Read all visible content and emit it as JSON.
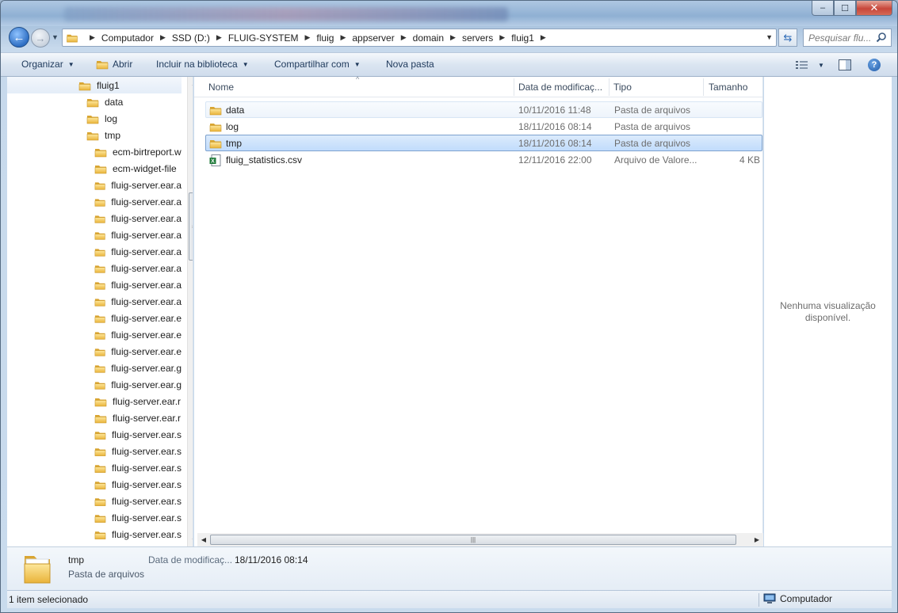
{
  "window": {
    "caption_buttons": {
      "minimize": "‒",
      "maximize": "☐",
      "close": "✕"
    }
  },
  "navigation": {
    "back_glyph": "←",
    "forward_glyph": "→",
    "recent_glyph": "▼",
    "breadcrumbs": [
      "Computador",
      "SSD (D:)",
      "FLUIG-SYSTEM",
      "fluig",
      "appserver",
      "domain",
      "servers",
      "fluig1"
    ],
    "refresh_glyph": "⇆",
    "search_placeholder": "Pesquisar flu..."
  },
  "toolbar": {
    "organize": "Organizar",
    "open": "Abrir",
    "include_library": "Incluir na biblioteca",
    "share": "Compartilhar com",
    "new_folder": "Nova pasta",
    "help": "?"
  },
  "tree": {
    "items": [
      {
        "label": "fluig1",
        "level": 0,
        "selected": true
      },
      {
        "label": "data",
        "level": 1
      },
      {
        "label": "log",
        "level": 1
      },
      {
        "label": "tmp",
        "level": 1
      },
      {
        "label": "ecm-birtreport.w",
        "level": 2
      },
      {
        "label": "ecm-widget-file",
        "level": 2
      },
      {
        "label": "fluig-server.ear.a",
        "level": 2
      },
      {
        "label": "fluig-server.ear.a",
        "level": 2
      },
      {
        "label": "fluig-server.ear.a",
        "level": 2
      },
      {
        "label": "fluig-server.ear.a",
        "level": 2
      },
      {
        "label": "fluig-server.ear.a",
        "level": 2
      },
      {
        "label": "fluig-server.ear.a",
        "level": 2
      },
      {
        "label": "fluig-server.ear.a",
        "level": 2
      },
      {
        "label": "fluig-server.ear.a",
        "level": 2
      },
      {
        "label": "fluig-server.ear.e",
        "level": 2
      },
      {
        "label": "fluig-server.ear.e",
        "level": 2
      },
      {
        "label": "fluig-server.ear.e",
        "level": 2
      },
      {
        "label": "fluig-server.ear.g",
        "level": 2
      },
      {
        "label": "fluig-server.ear.g",
        "level": 2
      },
      {
        "label": "fluig-server.ear.r",
        "level": 2
      },
      {
        "label": "fluig-server.ear.r",
        "level": 2
      },
      {
        "label": "fluig-server.ear.s",
        "level": 2
      },
      {
        "label": "fluig-server.ear.s",
        "level": 2
      },
      {
        "label": "fluig-server.ear.s",
        "level": 2
      },
      {
        "label": "fluig-server.ear.s",
        "level": 2
      },
      {
        "label": "fluig-server.ear.s",
        "level": 2
      },
      {
        "label": "fluig-server.ear.s",
        "level": 2
      },
      {
        "label": "fluig-server.ear.s",
        "level": 2
      }
    ]
  },
  "columns": {
    "name": "Nome",
    "date": "Data de modificaç...",
    "type": "Tipo",
    "size": "Tamanho"
  },
  "files": [
    {
      "name": "data",
      "date": "10/11/2016 11:48",
      "type": "Pasta de arquivos",
      "size": "",
      "icon": "folder-icon",
      "state": "hover"
    },
    {
      "name": "log",
      "date": "18/11/2016 08:14",
      "type": "Pasta de arquivos",
      "size": "",
      "icon": "folder-icon",
      "state": ""
    },
    {
      "name": "tmp",
      "date": "18/11/2016 08:14",
      "type": "Pasta de arquivos",
      "size": "",
      "icon": "folder-icon",
      "state": "selected"
    },
    {
      "name": "fluig_statistics.csv",
      "date": "12/11/2016 22:00",
      "type": "Arquivo de Valore...",
      "size": "4 KB",
      "icon": "excel-csv-icon",
      "state": ""
    }
  ],
  "preview": {
    "message": "Nenhuma visualização disponível."
  },
  "details": {
    "name": "tmp",
    "type": "Pasta de arquivos",
    "date_label": "Data de modificaç...",
    "date_value": "18/11/2016 08:14"
  },
  "status": {
    "selection": "1 item selecionado",
    "location": "Computador"
  },
  "colors": {
    "selection_fill": "#c1dcfc",
    "selection_border": "#7da2ce",
    "folder_yellow": "#f1c44b",
    "toolbar_text": "#1e395b"
  }
}
